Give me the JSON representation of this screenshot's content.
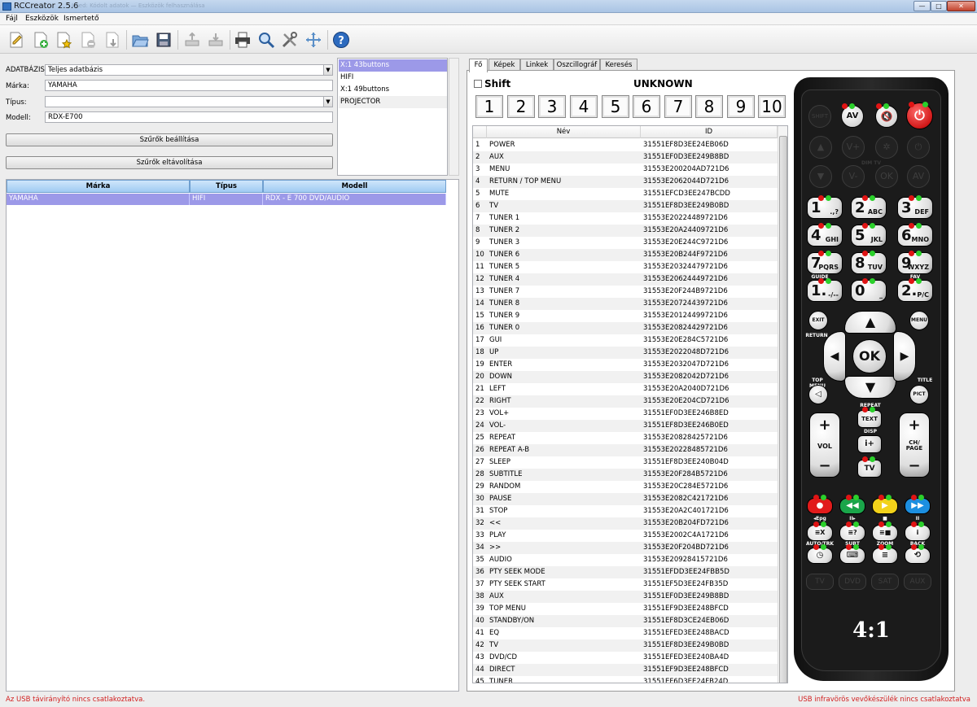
{
  "window": {
    "title": "RCCreator 2.5.6",
    "title_extra": "Used: Kódolt adatok — Eszközök felhasználása"
  },
  "menu": [
    "Fájl",
    "Eszközök",
    "Ismertető"
  ],
  "toolbar": [
    "new-document-icon",
    "new-add-icon",
    "new-star-icon",
    "remove-icon",
    "import-icon",
    "open-folder-icon",
    "save-icon",
    "upload-icon",
    "download-icon",
    "print-icon",
    "search-icon",
    "tools-icon",
    "move-icon",
    "help-icon"
  ],
  "filters": {
    "database_label": "ADATBÁZIS:",
    "database_value": "Teljes adatbázis",
    "brand_label": "Márka:",
    "brand_value": "YAMAHA",
    "type_label": "Típus:",
    "type_value": "",
    "model_label": "Modell:",
    "model_value": "RDX-E700",
    "apply_button": "Szűrők beállítása",
    "remove_button": "Szűrők eltávolítása"
  },
  "list": [
    "X:1 43buttons",
    "HIFI",
    "X:1 49buttons",
    "PROJECTOR"
  ],
  "grid": {
    "headers": [
      "Márka",
      "Típus",
      "Modell"
    ],
    "row": [
      "YAMAHA",
      "HIFI",
      "RDX - E 700 DVD/AUDIO"
    ]
  },
  "tabs": [
    "Fő",
    "Képek",
    "Linkek",
    "Oszcillográf",
    "Keresés"
  ],
  "shift_label": "Shift",
  "device_label": "UNKNOWN",
  "number_buttons": [
    "1",
    "2",
    "3",
    "4",
    "5",
    "6",
    "7",
    "8",
    "9",
    "10"
  ],
  "cmd_headers": [
    "Név",
    "ID"
  ],
  "commands": [
    [
      "1",
      "POWER",
      "31551EF8D3EE24EB06D"
    ],
    [
      "2",
      "AUX",
      "31551EF0D3EE249B8BD"
    ],
    [
      "3",
      "MENU",
      "31553E200204AD721D6"
    ],
    [
      "4",
      "RETURN / TOP MENU",
      "31553E2062044D721D6"
    ],
    [
      "5",
      "MUTE",
      "31551EFCD3EE247BCDD"
    ],
    [
      "6",
      "TV",
      "31551EF8D3EE249B0BD"
    ],
    [
      "7",
      "TUNER 1",
      "31553E20224489721D6"
    ],
    [
      "8",
      "TUNER 2",
      "31553E20A24409721D6"
    ],
    [
      "9",
      "TUNER 3",
      "31553E20E244C9721D6"
    ],
    [
      "10",
      "TUNER 6",
      "31553E20B244F9721D6"
    ],
    [
      "11",
      "TUNER 5",
      "31553E20324479721D6"
    ],
    [
      "12",
      "TUNER 4",
      "31553E20624449721D6"
    ],
    [
      "13",
      "TUNER 7",
      "31553E20F244B9721D6"
    ],
    [
      "14",
      "TUNER 8",
      "31553E20724439721D6"
    ],
    [
      "15",
      "TUNER 9",
      "31553E20124499721D6"
    ],
    [
      "16",
      "TUNER 0",
      "31553E20824429721D6"
    ],
    [
      "17",
      "GUI",
      "31553E20E284C5721D6"
    ],
    [
      "18",
      "UP",
      "31553E2022048D721D6"
    ],
    [
      "19",
      "ENTER",
      "31553E2032047D721D6"
    ],
    [
      "20",
      "DOWN",
      "31553E2082042D721D6"
    ],
    [
      "21",
      "LEFT",
      "31553E20A2040D721D6"
    ],
    [
      "22",
      "RIGHT",
      "31553E20E204CD721D6"
    ],
    [
      "23",
      "VOL+",
      "31551EF0D3EE246B8ED"
    ],
    [
      "24",
      "VOL-",
      "31551EF8D3EE246B0ED"
    ],
    [
      "25",
      "REPEAT",
      "31553E20828425721D6"
    ],
    [
      "26",
      "REPEAT A-B",
      "31553E20228485721D6"
    ],
    [
      "27",
      "SLEEP",
      "31551EF8D3EE240B04D"
    ],
    [
      "28",
      "SUBTITLE",
      "31553E20F284B5721D6"
    ],
    [
      "29",
      "RANDOM",
      "31553E20C284E5721D6"
    ],
    [
      "30",
      "PAUSE",
      "31553E2082C421721D6"
    ],
    [
      "31",
      "STOP",
      "31553E20A2C401721D6"
    ],
    [
      "32",
      "<<",
      "31553E20B204FD721D6"
    ],
    [
      "33",
      "PLAY",
      "31553E2002C4A1721D6"
    ],
    [
      "34",
      ">>",
      "31553E20F204BD721D6"
    ],
    [
      "35",
      "AUDIO",
      "31553E20928415721D6"
    ],
    [
      "36",
      "PTY SEEK MODE",
      "31551EFDD3EE24FBB5D"
    ],
    [
      "37",
      "PTY SEEK START",
      "31551EF5D3EE24FB35D"
    ],
    [
      "38",
      "AUX",
      "31551EF0D3EE249B8BD"
    ],
    [
      "39",
      "TOP MENU",
      "31551EF9D3EE248BFCD"
    ],
    [
      "40",
      "STANDBY/ON",
      "31551EF8D3CE24EB06D"
    ],
    [
      "41",
      "EQ",
      "31551EFED3EE248BACD"
    ],
    [
      "42",
      "TV",
      "31551EF8D3EE249B0BD"
    ],
    [
      "43",
      "DVD/CD",
      "31551EFED3EE240BA4D"
    ],
    [
      "44",
      "DIRECT",
      "31551EF9D3EE248BFCD"
    ],
    [
      "45",
      "TUNER",
      "31551EF6D3EE24FB24D"
    ]
  ],
  "remote": {
    "brand": "4:1",
    "top": [
      "SHIFT",
      "AV",
      "mute-icon",
      "power-icon"
    ],
    "dim_row1": [
      "▲",
      "V+",
      "✲",
      "⏻"
    ],
    "dim_row2": [
      "▼",
      "V-",
      "OK",
      "AV"
    ],
    "dim_mid_label": "DIM TV",
    "digits": [
      [
        "1",
        ".,?"
      ],
      [
        "2",
        "ABC"
      ],
      [
        "3",
        "DEF"
      ],
      [
        "4",
        "GHI"
      ],
      [
        "5",
        "JKL"
      ],
      [
        "6",
        "MNO"
      ],
      [
        "7",
        "PQRS"
      ],
      [
        "8",
        "TUV"
      ],
      [
        "9",
        "WXYZ"
      ],
      [
        "1.",
        "-/--"
      ],
      [
        "0",
        "_"
      ],
      [
        "2.",
        "P/C"
      ]
    ],
    "guide_label": "GUIDE",
    "fav_label": "FAV",
    "exit": "EXIT",
    "return_label": "RETURN",
    "menu": "MENU",
    "ok": "OK",
    "top_menu_label": "TOP MENU",
    "title_label": "TITLE",
    "pict": "PICT",
    "repeat_label": "REPEAT",
    "text": "TEXT",
    "disp_label": "DISP",
    "tv": "TV",
    "vol": "VOL",
    "ch_page": "CH/\nPAGE",
    "color_labels": [
      "◂Epg",
      "II▸",
      "■",
      "II"
    ],
    "fn_row": [
      "≡X",
      "≡?",
      "≡■",
      "i"
    ],
    "auto_trk": "AUTO/TRK",
    "subt": "SUBT",
    "zoom": "ZOOM",
    "back": "BACK",
    "sources": [
      "TV",
      "DVD",
      "SAT",
      "AUX"
    ],
    "colors": {
      "red": "#e11b1b",
      "green": "#1aa54a",
      "yellow": "#f2d21a",
      "blue": "#1c8fe0"
    }
  },
  "status": {
    "left": "Az USB távirányító nincs csatlakoztatva.",
    "right": "USB infravörös vevőkészülék nincs csatlakoztatva"
  }
}
